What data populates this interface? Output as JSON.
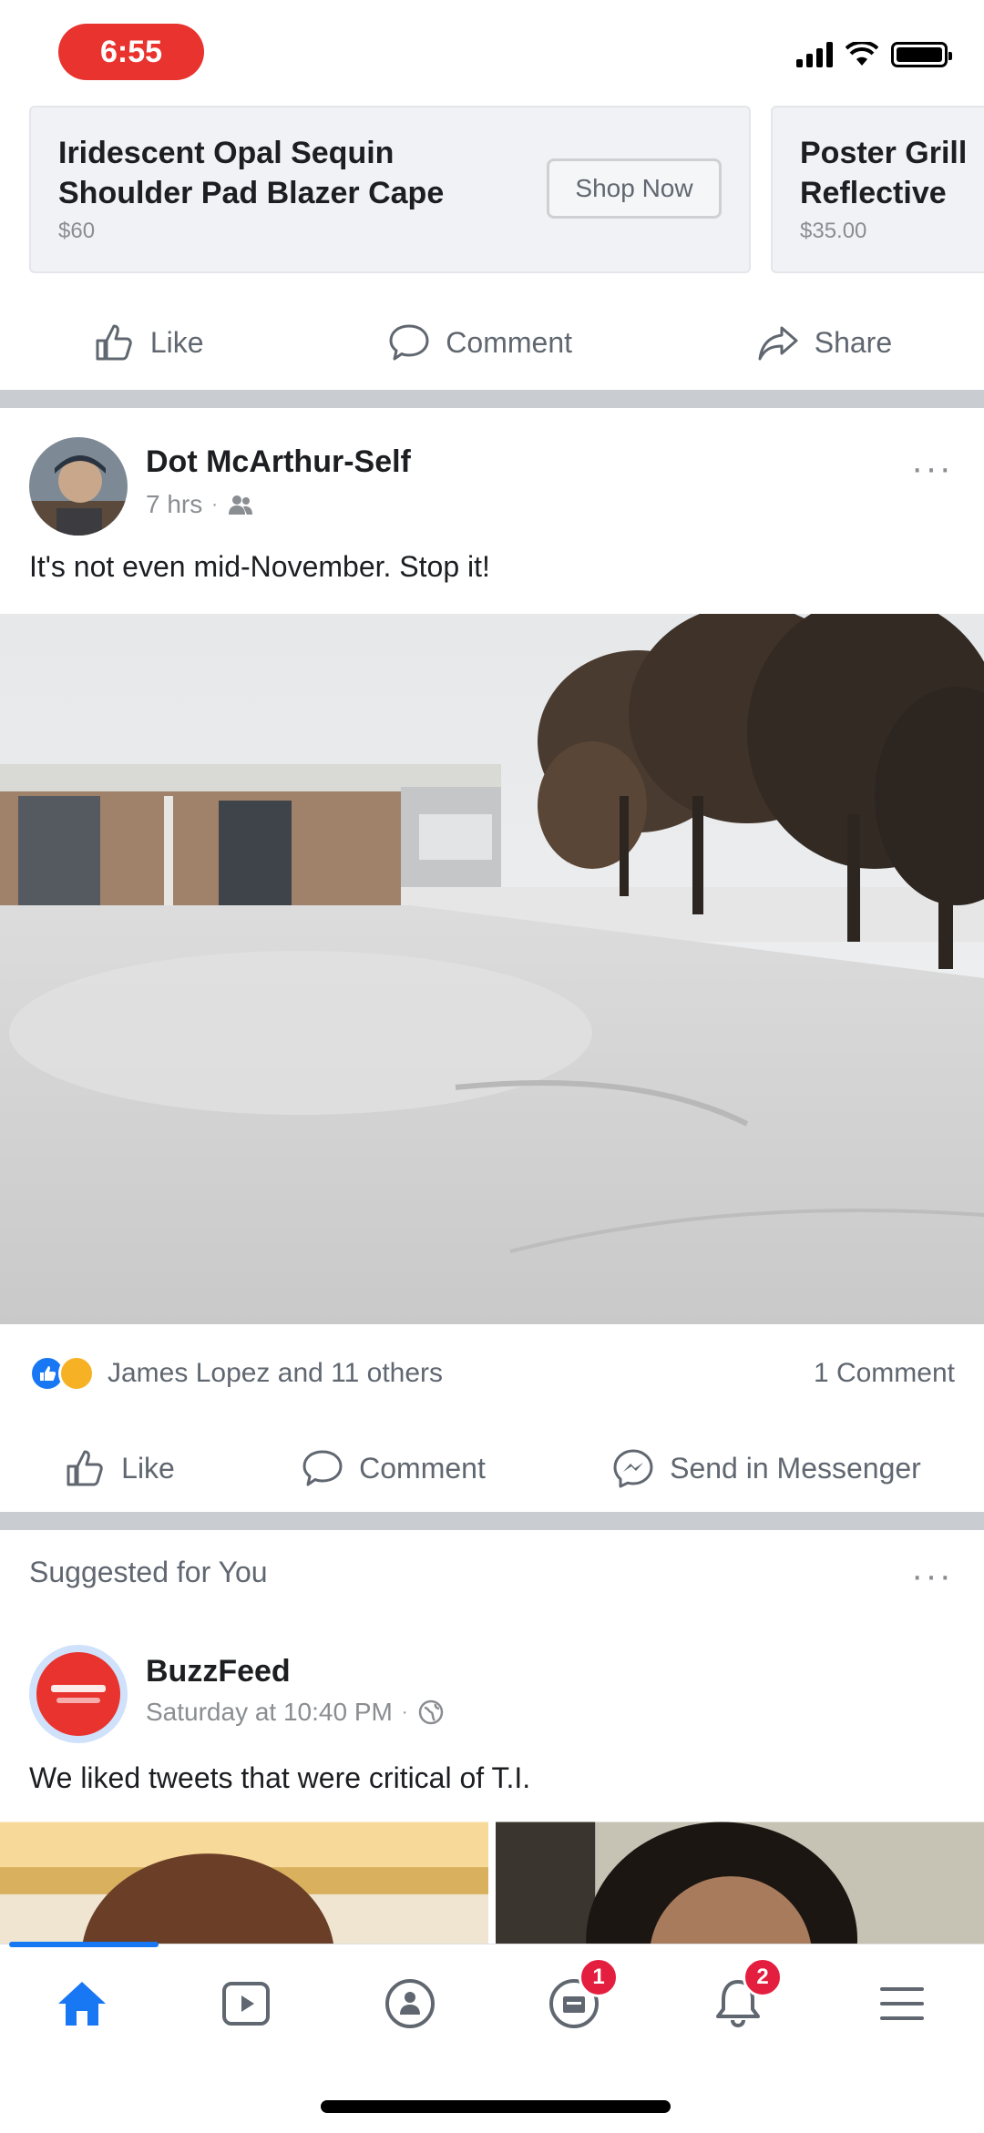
{
  "status_bar": {
    "time": "6:55"
  },
  "ad_carousel": {
    "cards": [
      {
        "title": "Iridescent Opal Sequin Shoulder Pad Blazer Cape",
        "price": "$60",
        "button": "Shop Now"
      },
      {
        "title": "Poster Grill Reflective",
        "price": "$35.00"
      }
    ]
  },
  "actions_top": {
    "like": "Like",
    "comment": "Comment",
    "share": "Share"
  },
  "post": {
    "author": "Dot McArthur-Self",
    "time": "7 hrs",
    "privacy_icon": "friends-icon",
    "text": "It's not even mid-November. Stop it!",
    "reactions_text": "James Lopez and 11 others",
    "comments_count": "1 Comment",
    "actions": {
      "like": "Like",
      "comment": "Comment",
      "send": "Send in Messenger"
    }
  },
  "suggested": {
    "section_title": "Suggested for You",
    "author": "BuzzFeed",
    "time": "Saturday at 10:40 PM",
    "privacy_icon": "public-globe-icon",
    "text": "We liked tweets that were critical of T.I."
  },
  "tab_bar": {
    "tabs": [
      {
        "name": "home",
        "badge": ""
      },
      {
        "name": "watch",
        "badge": ""
      },
      {
        "name": "groups",
        "badge": ""
      },
      {
        "name": "marketplace",
        "badge": "1"
      },
      {
        "name": "notifications",
        "badge": "2"
      },
      {
        "name": "menu",
        "badge": ""
      }
    ]
  },
  "colors": {
    "accent": "#1877f2",
    "badge": "#e41e3f",
    "time_pill": "#e8332e",
    "separator": "#c9ccd1"
  }
}
